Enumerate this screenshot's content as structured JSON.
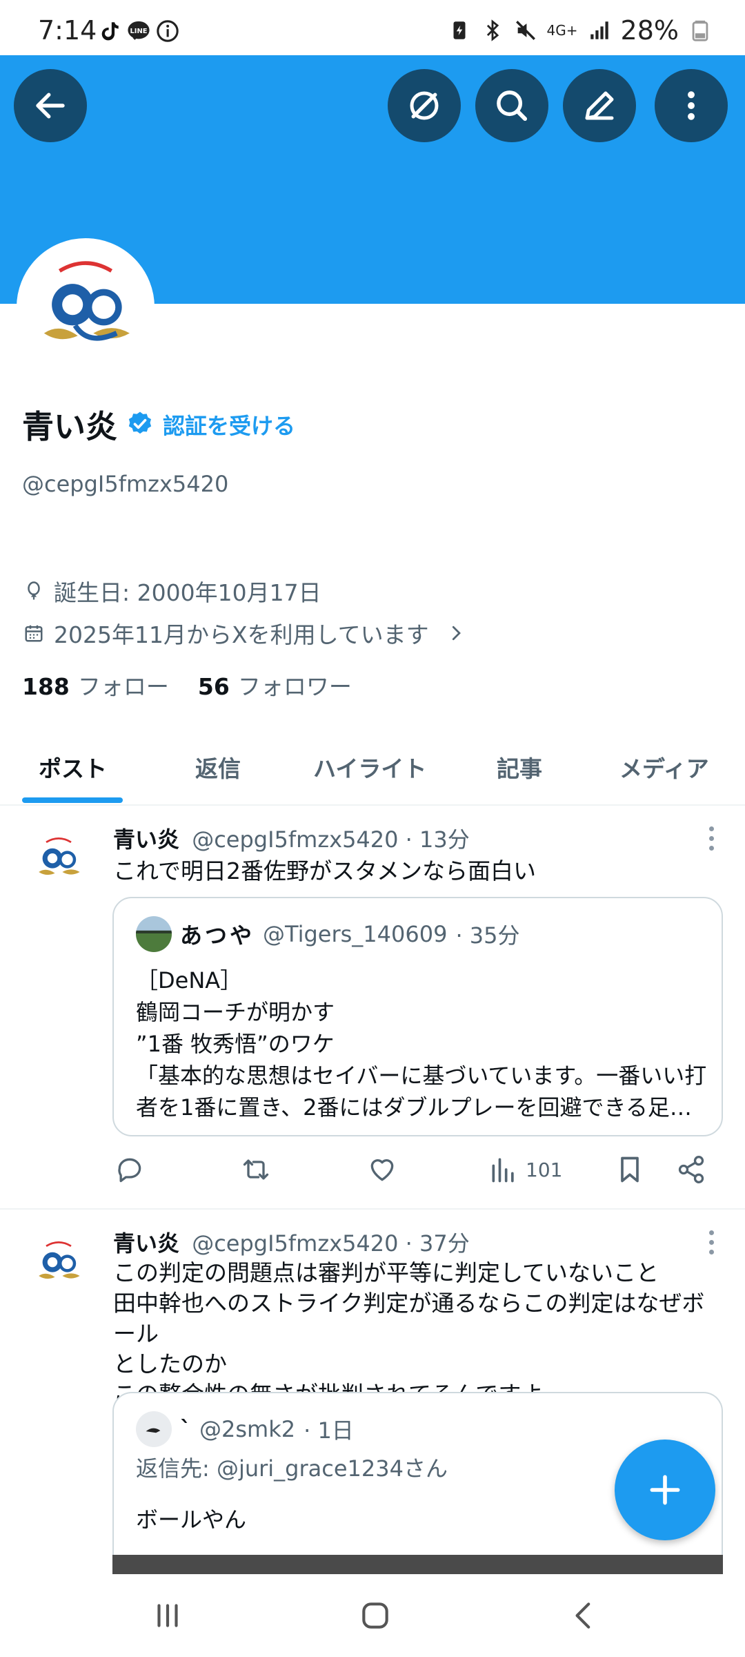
{
  "status_bar": {
    "time": "7:14",
    "network": "4G+",
    "battery": "28%",
    "icons": [
      "tiktok-icon",
      "line-icon",
      "info-icon",
      "battery-saver-icon",
      "bluetooth-icon",
      "mute-icon",
      "signal-icon",
      "battery-icon"
    ]
  },
  "header": {
    "buttons": [
      "back-icon",
      "grok-icon",
      "search-icon",
      "edit-icon",
      "more-icon"
    ],
    "banner_color": "#1d9bf0"
  },
  "profile": {
    "name": "青い炎",
    "verify_label": "認証を受ける",
    "handle": "@cepgI5fmzx5420",
    "birthday": "誕生日: 2000年10月17日",
    "joined": "2025年11月からXを利用しています",
    "following_count": "188",
    "following_label": "フォロー",
    "followers_count": "56",
    "followers_label": "フォロワー"
  },
  "tabs": [
    {
      "label": "ポスト",
      "active": true
    },
    {
      "label": "返信",
      "active": false
    },
    {
      "label": "ハイライト",
      "active": false
    },
    {
      "label": "記事",
      "active": false
    },
    {
      "label": "メディア",
      "active": false
    }
  ],
  "posts": [
    {
      "name": "青い炎",
      "handle": "@cepgI5fmzx5420",
      "time": "· 13分",
      "text": "これで明日2番佐野がスタメンなら面白い",
      "quote": {
        "name": "あつや",
        "handle": "@Tigers_140609",
        "time": "· 35分",
        "lines": [
          "［DeNA］",
          "鶴岡コーチが明かす",
          "”1番 牧秀悟”のワケ",
          "「基本的な思想はセイバーに基づいています。一番いい打",
          "者を1番に置き、2番にはダブルプレーを回避できる足が…"
        ]
      },
      "views": "101"
    },
    {
      "name": "青い炎",
      "handle": "@cepgI5fmzx5420",
      "time": "· 37分",
      "lines": [
        "この判定の問題点は審判が平等に判定していないこと",
        "田中幹也へのストライク判定が通るならこの判定はなぜボール",
        "としたのか",
        "この整合性の無さが批判されてるんですよ"
      ],
      "quote": {
        "name": "`",
        "handle": "@2smk2",
        "time": "· 1日",
        "reply_to": "返信先: @juri_grace1234さん",
        "text": "ボールやん"
      }
    }
  ],
  "fab": {
    "icon": "plus-icon",
    "color": "#1d9bf0"
  },
  "nav_bar": [
    "recents-icon",
    "home-icon",
    "back-nav-icon"
  ]
}
